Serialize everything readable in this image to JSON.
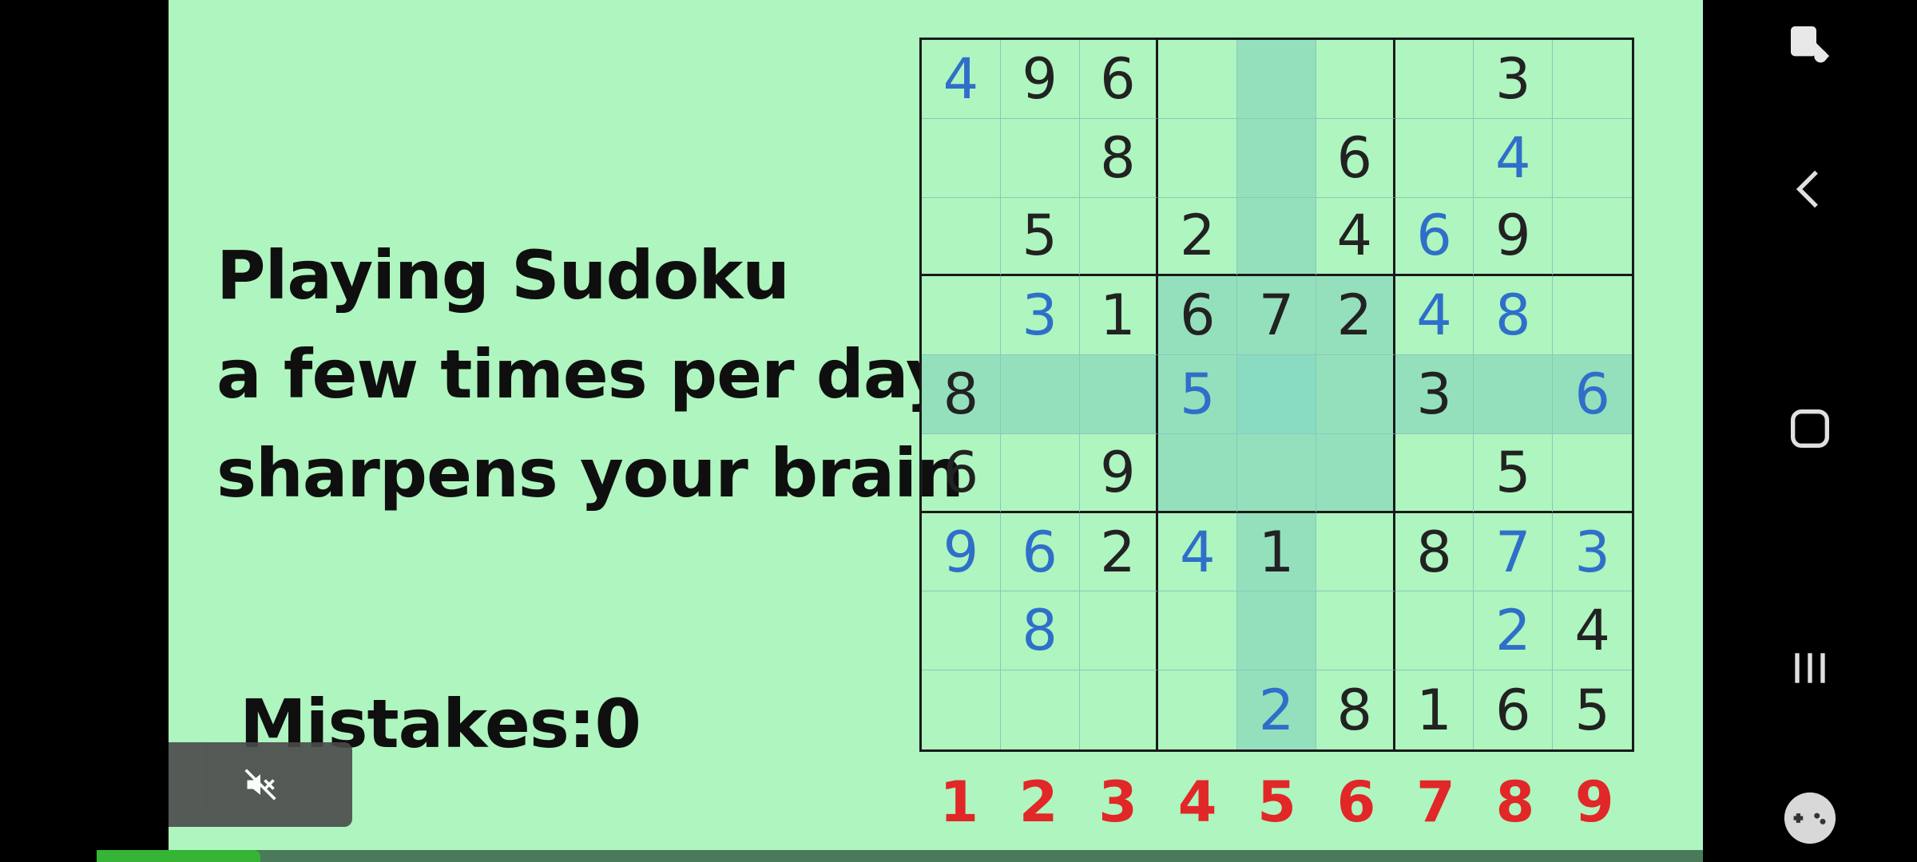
{
  "slogan": {
    "line1": "Playing Sudoku",
    "line2": "a few times per day",
    "line3": "sharpens your brain"
  },
  "mistakes_label": "Mistakes:0",
  "board": {
    "rows": [
      [
        "4",
        "9",
        "6",
        "",
        "",
        "",
        "",
        "3",
        ""
      ],
      [
        "",
        "",
        "8",
        "",
        "",
        "6",
        "",
        "4",
        ""
      ],
      [
        "",
        "5",
        "",
        "2",
        "",
        "4",
        "6",
        "9",
        ""
      ],
      [
        "",
        "3",
        "1",
        "6",
        "7",
        "2",
        "4",
        "8",
        ""
      ],
      [
        "8",
        "",
        "",
        "5",
        "",
        "",
        "3",
        "",
        "6"
      ],
      [
        "6",
        "",
        "9",
        "",
        "",
        "",
        "",
        "5",
        ""
      ],
      [
        "9",
        "6",
        "2",
        "4",
        "1",
        "",
        "8",
        "7",
        "3"
      ],
      [
        "",
        "8",
        "",
        "",
        "",
        "",
        "",
        "2",
        "4"
      ],
      [
        "",
        "",
        "",
        "",
        "2",
        "8",
        "1",
        "6",
        "5"
      ]
    ],
    "entered": [
      [
        1,
        0,
        0,
        0,
        0,
        0,
        0,
        0,
        0
      ],
      [
        0,
        0,
        0,
        0,
        0,
        0,
        0,
        1,
        0
      ],
      [
        0,
        0,
        0,
        0,
        0,
        0,
        1,
        0,
        0
      ],
      [
        0,
        1,
        0,
        0,
        0,
        0,
        1,
        1,
        0
      ],
      [
        0,
        0,
        0,
        1,
        0,
        0,
        0,
        0,
        1
      ],
      [
        0,
        0,
        0,
        0,
        0,
        0,
        0,
        0,
        0
      ],
      [
        1,
        1,
        0,
        1,
        0,
        0,
        0,
        1,
        1
      ],
      [
        0,
        1,
        0,
        0,
        0,
        0,
        0,
        1,
        0
      ],
      [
        0,
        0,
        0,
        0,
        1,
        0,
        0,
        0,
        0
      ]
    ],
    "selected_row": 4,
    "selected_col": 4
  },
  "numpad": [
    "1",
    "2",
    "3",
    "4",
    "5",
    "6",
    "7",
    "8",
    "9"
  ],
  "progress": 0.06,
  "colors": {
    "background": "#aef5bf",
    "highlight": "#94e0bd",
    "given_digit": "#222222",
    "entered_digit": "#2f6fc9",
    "numpad_digit": "#e12727"
  },
  "icons": {
    "mute": "volume-muted-icon",
    "screenshot": "screenshot-edit-icon",
    "back": "back-chevron-icon",
    "home": "home-square-icon",
    "recents": "recents-bars-icon",
    "game": "gamepad-icon"
  }
}
